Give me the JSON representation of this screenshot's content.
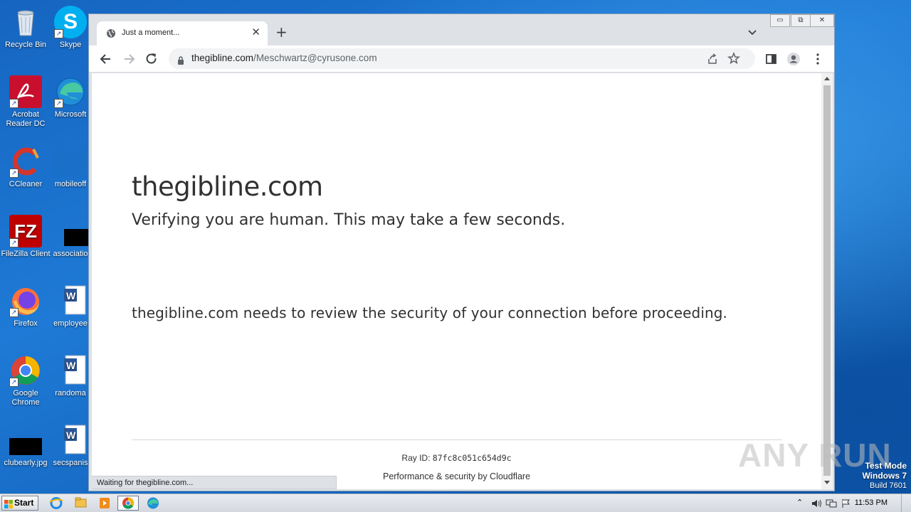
{
  "desktop": {
    "icons": [
      {
        "label": "Recycle Bin"
      },
      {
        "label": "Skype"
      },
      {
        "label": "Acrobat Reader DC"
      },
      {
        "label": "Microsoft"
      },
      {
        "label": "CCleaner"
      },
      {
        "label": "mobileoff"
      },
      {
        "label": "FileZilla Client"
      },
      {
        "label": "associatio"
      },
      {
        "label": "Firefox"
      },
      {
        "label": "employee"
      },
      {
        "label": "Google Chrome"
      },
      {
        "label": "randoma"
      },
      {
        "label": "clubearly.jpg"
      },
      {
        "label": "secspanis"
      }
    ]
  },
  "browser": {
    "tab": {
      "title": "Just a moment...",
      "icon": "globe-icon"
    },
    "address": {
      "host": "thegibline.com",
      "path": "/Meschwartz@cyrusone.com"
    }
  },
  "page": {
    "heading": "thegibline.com",
    "verify_text": "Verifying you are human. This may take a few seconds.",
    "review_text": "thegibline.com needs to review the security of your connection before proceeding.",
    "ray_label": "Ray ID:",
    "ray_id": "87fc8c051c654d9c",
    "footer": "Performance & security by Cloudflare"
  },
  "status_bar": "Waiting for thegibline.com...",
  "watermark": "ANY RUN",
  "os": {
    "test_mode": "Test Mode",
    "windows": "Windows 7",
    "build": "Build 7601",
    "start_label": "Start",
    "clock": "11:53 PM"
  },
  "colors": {
    "desktop": "#1a6fc9",
    "chrome_frame": "#dee1e6",
    "page_text": "#313131"
  }
}
